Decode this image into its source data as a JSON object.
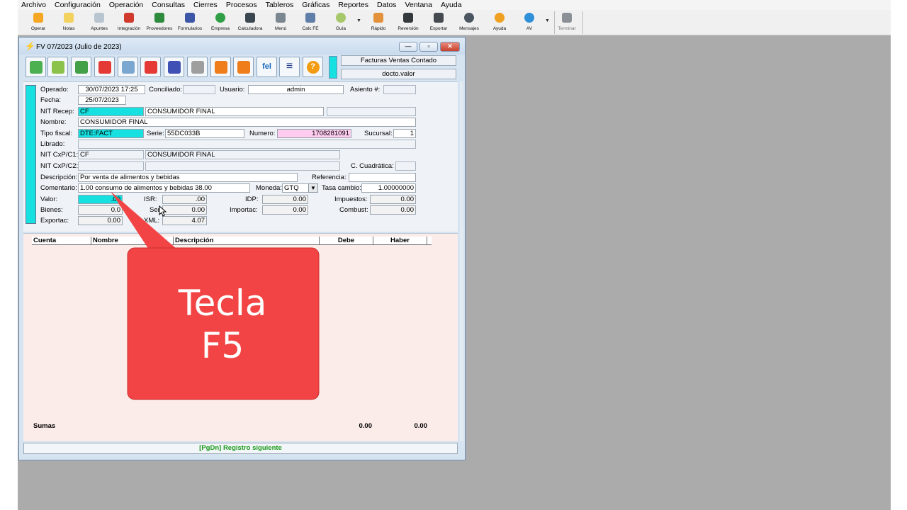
{
  "menu": [
    "Archivo",
    "Configuración",
    "Operación",
    "Consultas",
    "Cierres",
    "Procesos",
    "Tableros",
    "Gráficas",
    "Reportes",
    "Datos",
    "Ventana",
    "Ayuda"
  ],
  "toolbar": [
    {
      "label": "Operar",
      "icon": "lightning-icon",
      "color": "#f5a623"
    },
    {
      "label": "Notas",
      "icon": "note-icon",
      "color": "#f2d15c"
    },
    {
      "label": "Apuntes",
      "icon": "notebook-icon",
      "color": "#b8c4cf"
    },
    {
      "label": "Integración",
      "icon": "integration-icon",
      "color": "#d0392b"
    },
    {
      "label": "Proveedores",
      "icon": "supplier-icon",
      "color": "#2e8b3e"
    },
    {
      "label": "Formularios",
      "icon": "form-grid-icon",
      "color": "#3b56a6"
    },
    {
      "label": "Empresa",
      "icon": "refresh-icon",
      "color": "#2f9e44"
    },
    {
      "label": "Calculadora",
      "icon": "calculator-icon",
      "color": "#3b4750"
    },
    {
      "label": "Menú",
      "icon": "menu-icon",
      "color": "#7a8790"
    },
    {
      "label": "Calc FE",
      "icon": "calc-fe-icon",
      "color": "#5f7fa8"
    },
    {
      "label": "Guía",
      "icon": "chat-bubble-icon",
      "color": "#a6c86a"
    },
    {
      "label": "Rápido",
      "icon": "rocket-icon",
      "color": "#e3913a"
    },
    {
      "label": "Reversión",
      "icon": "binoculars-icon",
      "color": "#34393e"
    },
    {
      "label": "Exportar",
      "icon": "graduation-cap-icon",
      "color": "#444a50"
    },
    {
      "label": "Mensajes",
      "icon": "message-icon",
      "color": "#4a5560"
    },
    {
      "label": "Ayuda",
      "icon": "help-icon",
      "color": "#f0a020"
    },
    {
      "label": "AV",
      "icon": "av-icon",
      "color": "#2f8fd8"
    },
    {
      "label": "Terminar",
      "icon": "exit-door-icon",
      "color": "#8a9096"
    }
  ],
  "window": {
    "title": "FV 07/2023 (Julio de 2023)",
    "controls": {
      "minimize": "—",
      "restore": "▫",
      "close": "✕"
    }
  },
  "action_toolbar": [
    {
      "icon": "import-icon",
      "color": "#4caf50",
      "text": ""
    },
    {
      "icon": "export-icon",
      "color": "#8bc34a",
      "text": ""
    },
    {
      "icon": "new-document-icon",
      "color": "#43a047",
      "text": ""
    },
    {
      "icon": "edit-pencil-icon",
      "color": "#e53935",
      "text": ""
    },
    {
      "icon": "recycle-bin-icon",
      "color": "#7aa7cf",
      "text": ""
    },
    {
      "icon": "cancel-document-icon",
      "color": "#e53935",
      "text": ""
    },
    {
      "icon": "grid-delete-icon",
      "color": "#3f51b5",
      "text": ""
    },
    {
      "icon": "clipboard-icon",
      "color": "#9e9e9e",
      "text": ""
    },
    {
      "icon": "printer-icon",
      "color": "#ef7d1a",
      "text": ""
    },
    {
      "icon": "printer-alt-icon",
      "color": "#ef7d1a",
      "text": ""
    },
    {
      "icon": "fel-icon",
      "color": "#1565c0",
      "text": "fel"
    },
    {
      "icon": "list-icon",
      "color": "#1e3a8a",
      "text": "≡"
    },
    {
      "icon": "help-icon",
      "color": "#f39c12",
      "text": "?"
    }
  ],
  "header_boxes": {
    "doc_type": "Facturas Ventas Contado",
    "doc_value": "docto.valor"
  },
  "form": {
    "operado": {
      "label": "Operado:",
      "value": "30/07/2023 17:25"
    },
    "conciliado": {
      "label": "Conciliado:",
      "value": ""
    },
    "usuario": {
      "label": "Usuario:",
      "value": "admin"
    },
    "asiento": {
      "label": "Asiento #:",
      "value": ""
    },
    "fecha": {
      "label": "Fecha:",
      "value": "25/07/2023"
    },
    "nit_recep": {
      "label": "NIT Recep:",
      "value": "CF",
      "name": "CONSUMIDOR FINAL"
    },
    "nombre": {
      "label": "Nombre:",
      "value": "CONSUMIDOR FINAL"
    },
    "tipo_fiscal": {
      "label": "Tipo fiscal:",
      "value": "DTE:FACT"
    },
    "serie": {
      "label": "Serie:",
      "value": "55DC033B"
    },
    "numero": {
      "label": "Numero:",
      "value": "1708281091"
    },
    "sucursal": {
      "label": "Sucursal:",
      "value": "1"
    },
    "librado": {
      "label": "Librado:",
      "value": ""
    },
    "nit_cxp1": {
      "label": "NIT CxP/C1:",
      "value": "CF",
      "name": "CONSUMIDOR FINAL"
    },
    "nit_cxp2": {
      "label": "NIT CxP/C2:",
      "value": ""
    },
    "c_cuadratica": {
      "label": "C. Cuadrática:",
      "value": ""
    },
    "descripcion": {
      "label": "Descripción:",
      "value": "Por venta de alimentos y bebidas"
    },
    "referencia": {
      "label": "Referencia:",
      "value": ""
    },
    "comentario": {
      "label": "Comentario:",
      "value": "1.00 consumo de alimentos y bebidas 38.00"
    },
    "moneda": {
      "label": "Moneda:",
      "value": "GTQ"
    },
    "tasa_cambio": {
      "label": "Tasa cambio:",
      "value": "1.00000000"
    },
    "valor": {
      "label": "Valor:",
      "value": ".00"
    },
    "isr": {
      "label": "ISR:",
      "value": ".00"
    },
    "idp": {
      "label": "IDP:",
      "value": "0.00"
    },
    "impuestos": {
      "label": "Impuestos:",
      "value": "0.00"
    },
    "bienes": {
      "label": "Bienes:",
      "value": "0.0"
    },
    "servicios": {
      "label": "Servicios:",
      "value": "0.00"
    },
    "importac": {
      "label": "Importac:",
      "value": "0.00"
    },
    "combust": {
      "label": "Combust:",
      "value": "0.00"
    },
    "exportac": {
      "label": "Exportac:",
      "value": "0.00"
    },
    "xml": {
      "label": "XML:",
      "value": "4.07"
    }
  },
  "grid": {
    "columns": [
      "Cuenta",
      "Nombre",
      "Descripción",
      "Debe",
      "Haber"
    ],
    "sumas_label": "Sumas",
    "sumas_debe": "0.00",
    "sumas_haber": "0.00"
  },
  "status": "[PgDn] Registro siguiente",
  "callout": {
    "line1": "Tecla",
    "line2": "F5",
    "color": "#f24444"
  }
}
